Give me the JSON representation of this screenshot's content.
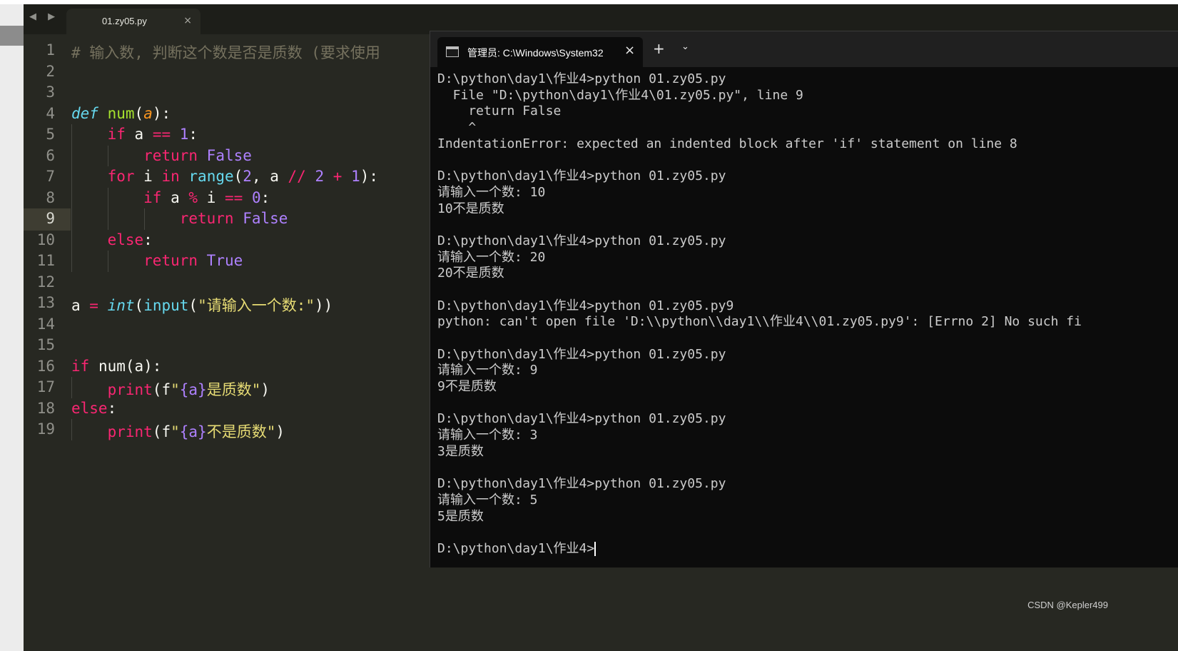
{
  "editor": {
    "tab_title": "01.zy05.py",
    "tab_close": "×",
    "nav_arrows": "◀ ▶",
    "current_line": 9,
    "lines": [
      {
        "n": "1",
        "tokens": [
          {
            "t": "# 输入数, 判断这个数是否是质数 (要求使用",
            "c": "cmt"
          }
        ]
      },
      {
        "n": "2",
        "tokens": []
      },
      {
        "n": "3",
        "tokens": []
      },
      {
        "n": "4",
        "tokens": [
          {
            "t": "def",
            "c": "def"
          },
          {
            "t": " ",
            "c": ""
          },
          {
            "t": "num",
            "c": "fn"
          },
          {
            "t": "(",
            "c": ""
          },
          {
            "t": "a",
            "c": "param"
          },
          {
            "t": "):",
            "c": ""
          }
        ]
      },
      {
        "n": "5",
        "tokens": [
          {
            "t": "    ",
            "c": ""
          },
          {
            "t": "if",
            "c": "kw"
          },
          {
            "t": " a ",
            "c": ""
          },
          {
            "t": "==",
            "c": "kw"
          },
          {
            "t": " ",
            "c": ""
          },
          {
            "t": "1",
            "c": "num"
          },
          {
            "t": ":",
            "c": ""
          }
        ]
      },
      {
        "n": "6",
        "tokens": [
          {
            "t": "        ",
            "c": ""
          },
          {
            "t": "return",
            "c": "kw"
          },
          {
            "t": " ",
            "c": ""
          },
          {
            "t": "False",
            "c": "const"
          }
        ]
      },
      {
        "n": "7",
        "tokens": [
          {
            "t": "    ",
            "c": ""
          },
          {
            "t": "for",
            "c": "kw"
          },
          {
            "t": " i ",
            "c": ""
          },
          {
            "t": "in",
            "c": "kw"
          },
          {
            "t": " ",
            "c": ""
          },
          {
            "t": "range",
            "c": "builtin"
          },
          {
            "t": "(",
            "c": ""
          },
          {
            "t": "2",
            "c": "num"
          },
          {
            "t": ", a ",
            "c": ""
          },
          {
            "t": "//",
            "c": "kw"
          },
          {
            "t": " ",
            "c": ""
          },
          {
            "t": "2",
            "c": "num"
          },
          {
            "t": " ",
            "c": ""
          },
          {
            "t": "+",
            "c": "kw"
          },
          {
            "t": " ",
            "c": ""
          },
          {
            "t": "1",
            "c": "num"
          },
          {
            "t": "):",
            "c": ""
          }
        ]
      },
      {
        "n": "8",
        "tokens": [
          {
            "t": "        ",
            "c": ""
          },
          {
            "t": "if",
            "c": "kw"
          },
          {
            "t": " a ",
            "c": ""
          },
          {
            "t": "%",
            "c": "kw"
          },
          {
            "t": " i ",
            "c": ""
          },
          {
            "t": "==",
            "c": "kw"
          },
          {
            "t": " ",
            "c": ""
          },
          {
            "t": "0",
            "c": "num"
          },
          {
            "t": ":",
            "c": ""
          }
        ]
      },
      {
        "n": "9",
        "tokens": [
          {
            "t": "            ",
            "c": ""
          },
          {
            "t": "return",
            "c": "kw"
          },
          {
            "t": " ",
            "c": ""
          },
          {
            "t": "False",
            "c": "const"
          }
        ]
      },
      {
        "n": "10",
        "tokens": [
          {
            "t": "    ",
            "c": ""
          },
          {
            "t": "else",
            "c": "kw"
          },
          {
            "t": ":",
            "c": ""
          }
        ]
      },
      {
        "n": "11",
        "tokens": [
          {
            "t": "        ",
            "c": ""
          },
          {
            "t": "return",
            "c": "kw"
          },
          {
            "t": " ",
            "c": ""
          },
          {
            "t": "True",
            "c": "const"
          }
        ]
      },
      {
        "n": "12",
        "tokens": []
      },
      {
        "n": "13",
        "tokens": [
          {
            "t": "a ",
            "c": ""
          },
          {
            "t": "=",
            "c": "kw"
          },
          {
            "t": " ",
            "c": ""
          },
          {
            "t": "int",
            "c": "builtin ital"
          },
          {
            "t": "(",
            "c": ""
          },
          {
            "t": "input",
            "c": "builtin"
          },
          {
            "t": "(",
            "c": ""
          },
          {
            "t": "\"请输入一个数:\"",
            "c": "str"
          },
          {
            "t": "))",
            "c": ""
          }
        ]
      },
      {
        "n": "14",
        "tokens": []
      },
      {
        "n": "15",
        "tokens": []
      },
      {
        "n": "16",
        "tokens": [
          {
            "t": "if",
            "c": "kw"
          },
          {
            "t": " num(a):",
            "c": ""
          }
        ]
      },
      {
        "n": "17",
        "tokens": [
          {
            "t": "    ",
            "c": ""
          },
          {
            "t": "print",
            "c": "kw"
          },
          {
            "t": "(",
            "c": ""
          },
          {
            "t": "f",
            "c": "fx"
          },
          {
            "t": "\"",
            "c": "str"
          },
          {
            "t": "{a}",
            "c": "fmt"
          },
          {
            "t": "是质数\"",
            "c": "str"
          },
          {
            "t": ")",
            "c": ""
          }
        ]
      },
      {
        "n": "18",
        "tokens": [
          {
            "t": "else",
            "c": "kw"
          },
          {
            "t": ":",
            "c": ""
          }
        ]
      },
      {
        "n": "19",
        "tokens": [
          {
            "t": "    ",
            "c": ""
          },
          {
            "t": "print",
            "c": "kw"
          },
          {
            "t": "(",
            "c": ""
          },
          {
            "t": "f",
            "c": "fx"
          },
          {
            "t": "\"",
            "c": "str"
          },
          {
            "t": "{a}",
            "c": "fmt"
          },
          {
            "t": "不是质数\"",
            "c": "str"
          },
          {
            "t": ")",
            "c": ""
          }
        ]
      }
    ]
  },
  "terminal": {
    "tab_title": "管理员: C:\\Windows\\System32",
    "close_glyph": "×",
    "new_tab_glyph": "+",
    "dropdown_glyph": "⌄",
    "lines": [
      "D:\\python\\day1\\作业4>python 01.zy05.py",
      "  File \"D:\\python\\day1\\作业4\\01.zy05.py\", line 9",
      "    return False",
      "    ^",
      "IndentationError: expected an indented block after 'if' statement on line 8",
      "",
      "D:\\python\\day1\\作业4>python 01.zy05.py",
      "请输入一个数: 10",
      "10不是质数",
      "",
      "D:\\python\\day1\\作业4>python 01.zy05.py",
      "请输入一个数: 20",
      "20不是质数",
      "",
      "D:\\python\\day1\\作业4>python 01.zy05.py9",
      "python: can't open file 'D:\\\\python\\\\day1\\\\作业4\\\\01.zy05.py9': [Errno 2] No such fi",
      "",
      "D:\\python\\day1\\作业4>python 01.zy05.py",
      "请输入一个数: 9",
      "9不是质数",
      "",
      "D:\\python\\day1\\作业4>python 01.zy05.py",
      "请输入一个数: 3",
      "3是质数",
      "",
      "D:\\python\\day1\\作业4>python 01.zy05.py",
      "请输入一个数: 5",
      "5是质数",
      "",
      "D:\\python\\day1\\作业4>"
    ]
  },
  "watermark": "CSDN @Kepler499"
}
